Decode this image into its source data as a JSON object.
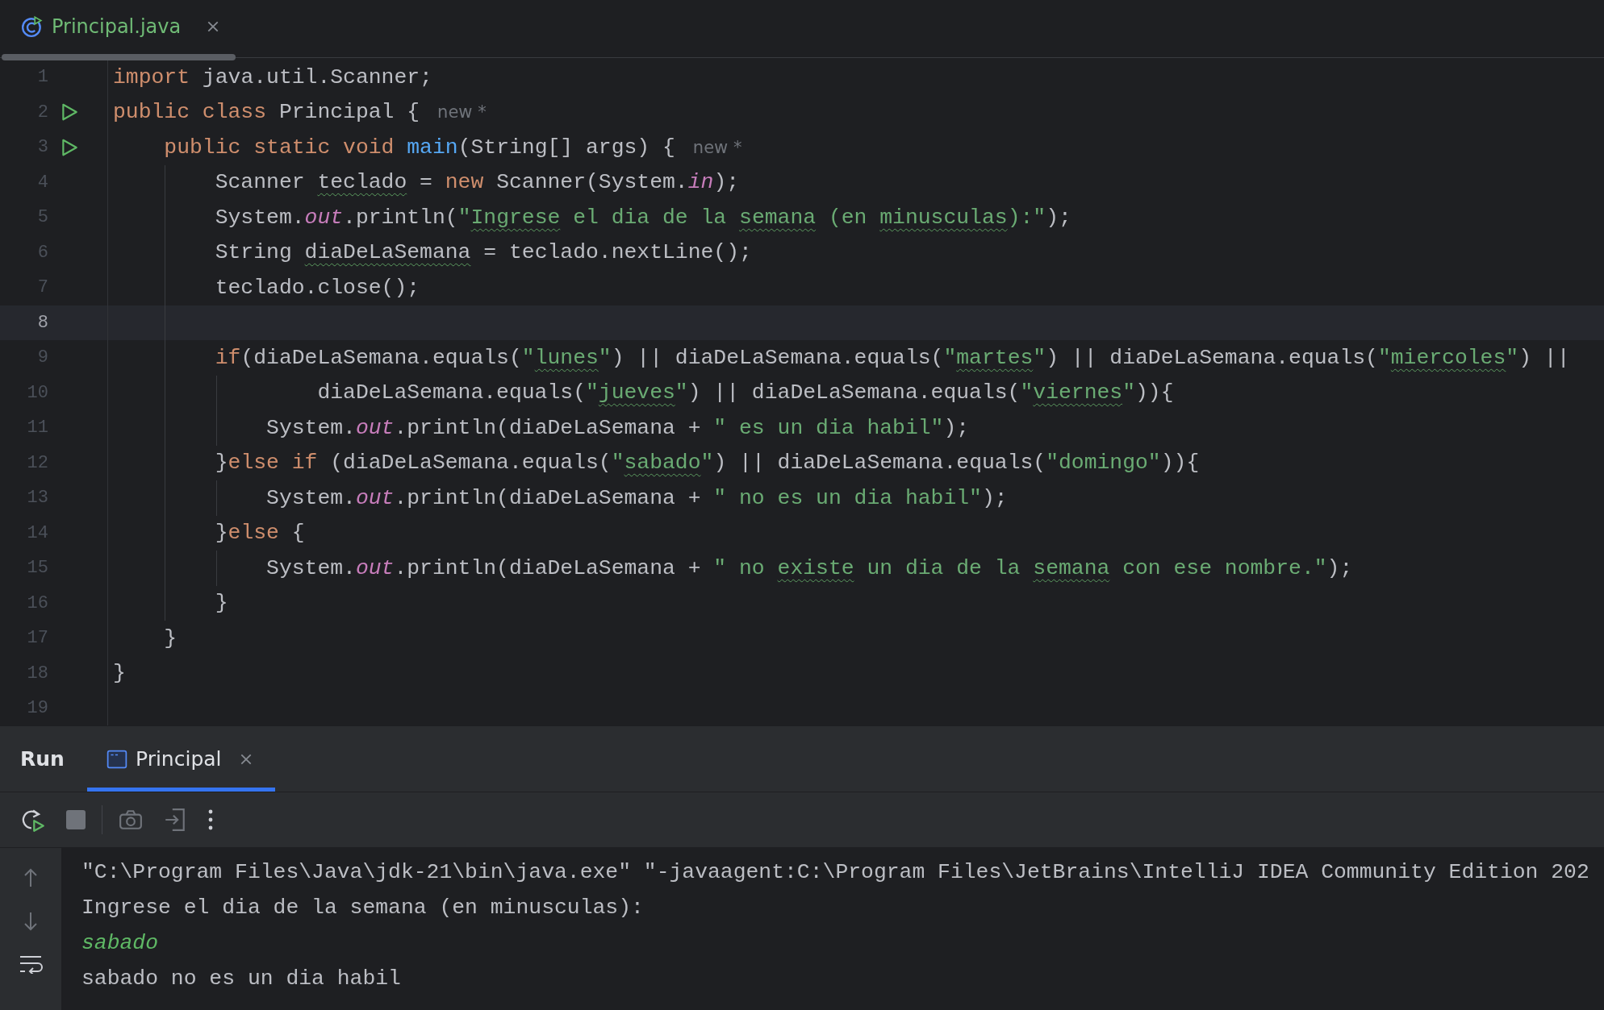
{
  "editor_tabs": [
    {
      "label": "Principal.java"
    }
  ],
  "code_lines": [
    {
      "no": "1",
      "run": false,
      "current": false,
      "tokens": [
        {
          "kind": "keyword",
          "text": "import"
        },
        {
          "kind": "plain",
          "text": " java.util.Scanner;"
        }
      ]
    },
    {
      "no": "2",
      "run": true,
      "current": false,
      "tokens": [
        {
          "kind": "keyword",
          "text": "public class"
        },
        {
          "kind": "plain",
          "text": " Principal {"
        }
      ],
      "hint": "new *"
    },
    {
      "no": "3",
      "run": true,
      "current": false,
      "tokens": [
        {
          "kind": "keyword",
          "text": "    public static void "
        },
        {
          "kind": "method",
          "text": "main"
        },
        {
          "kind": "plain",
          "text": "(String[] args) {"
        }
      ],
      "hint": "new *"
    },
    {
      "no": "4",
      "run": false,
      "current": false,
      "tokens": [
        {
          "kind": "plain",
          "text": "        Scanner "
        },
        {
          "kind": "misspelt",
          "text": "teclado"
        },
        {
          "kind": "plain",
          "text": " = "
        },
        {
          "kind": "keyword",
          "text": "new"
        },
        {
          "kind": "plain",
          "text": " Scanner(System."
        },
        {
          "kind": "field",
          "text": "in"
        },
        {
          "kind": "plain",
          "text": ");"
        }
      ]
    },
    {
      "no": "5",
      "run": false,
      "current": false,
      "tokens": [
        {
          "kind": "plain",
          "text": "        System."
        },
        {
          "kind": "field",
          "text": "out"
        },
        {
          "kind": "plain",
          "text": ".println("
        },
        {
          "kind": "string",
          "text": "\""
        },
        {
          "kind": "misspelt-string",
          "text": "Ingrese"
        },
        {
          "kind": "string",
          "text": " el dia de la "
        },
        {
          "kind": "misspelt-string",
          "text": "semana"
        },
        {
          "kind": "string",
          "text": " (en "
        },
        {
          "kind": "misspelt-string",
          "text": "minusculas"
        },
        {
          "kind": "string",
          "text": "):\""
        },
        {
          "kind": "plain",
          "text": ");"
        }
      ]
    },
    {
      "no": "6",
      "run": false,
      "current": false,
      "tokens": [
        {
          "kind": "plain",
          "text": "        String "
        },
        {
          "kind": "misspelt",
          "text": "diaDeLaSemana"
        },
        {
          "kind": "plain",
          "text": " = teclado.nextLine();"
        }
      ]
    },
    {
      "no": "7",
      "run": false,
      "current": false,
      "tokens": [
        {
          "kind": "plain",
          "text": "        teclado.close();"
        }
      ]
    },
    {
      "no": "8",
      "run": false,
      "current": true
    },
    {
      "no": "9",
      "run": false,
      "current": false,
      "tokens": [
        {
          "kind": "keyword",
          "text": "        if"
        },
        {
          "kind": "plain",
          "text": "(diaDeLaSemana.equals("
        },
        {
          "kind": "string",
          "text": "\""
        },
        {
          "kind": "misspelt-string",
          "text": "lunes"
        },
        {
          "kind": "string",
          "text": "\""
        },
        {
          "kind": "plain",
          "text": ") || diaDeLaSemana.equals("
        },
        {
          "kind": "string",
          "text": "\""
        },
        {
          "kind": "misspelt-string",
          "text": "martes"
        },
        {
          "kind": "string",
          "text": "\""
        },
        {
          "kind": "plain",
          "text": ") || diaDeLaSemana.equals("
        },
        {
          "kind": "string",
          "text": "\""
        },
        {
          "kind": "misspelt-string",
          "text": "miercoles"
        },
        {
          "kind": "string",
          "text": "\""
        },
        {
          "kind": "plain",
          "text": ") ||"
        }
      ]
    },
    {
      "no": "10",
      "run": false,
      "current": false,
      "tokens": [
        {
          "kind": "plain",
          "text": "                diaDeLaSemana.equals("
        },
        {
          "kind": "string",
          "text": "\""
        },
        {
          "kind": "misspelt-string",
          "text": "jueves"
        },
        {
          "kind": "string",
          "text": "\""
        },
        {
          "kind": "plain",
          "text": ") || diaDeLaSemana.equals("
        },
        {
          "kind": "string",
          "text": "\""
        },
        {
          "kind": "misspelt-string",
          "text": "viernes"
        },
        {
          "kind": "string",
          "text": "\""
        },
        {
          "kind": "plain",
          "text": ")){"
        }
      ]
    },
    {
      "no": "11",
      "run": false,
      "current": false,
      "tokens": [
        {
          "kind": "plain",
          "text": "            System."
        },
        {
          "kind": "field",
          "text": "out"
        },
        {
          "kind": "plain",
          "text": ".println(diaDeLaSemana + "
        },
        {
          "kind": "string",
          "text": "\" es un dia habil\""
        },
        {
          "kind": "plain",
          "text": ");"
        }
      ]
    },
    {
      "no": "12",
      "run": false,
      "current": false,
      "tokens": [
        {
          "kind": "plain",
          "text": "        }"
        },
        {
          "kind": "keyword",
          "text": "else if"
        },
        {
          "kind": "plain",
          "text": " (diaDeLaSemana.equals("
        },
        {
          "kind": "string",
          "text": "\""
        },
        {
          "kind": "misspelt-string",
          "text": "sabado"
        },
        {
          "kind": "string",
          "text": "\""
        },
        {
          "kind": "plain",
          "text": ") || diaDeLaSemana.equals("
        },
        {
          "kind": "string",
          "text": "\"domingo\""
        },
        {
          "kind": "plain",
          "text": ")){"
        }
      ]
    },
    {
      "no": "13",
      "run": false,
      "current": false,
      "tokens": [
        {
          "kind": "plain",
          "text": "            System."
        },
        {
          "kind": "field",
          "text": "out"
        },
        {
          "kind": "plain",
          "text": ".println(diaDeLaSemana + "
        },
        {
          "kind": "string",
          "text": "\" no es un dia habil\""
        },
        {
          "kind": "plain",
          "text": ");"
        }
      ]
    },
    {
      "no": "14",
      "run": false,
      "current": false,
      "tokens": [
        {
          "kind": "plain",
          "text": "        }"
        },
        {
          "kind": "keyword",
          "text": "else"
        },
        {
          "kind": "plain",
          "text": " {"
        }
      ]
    },
    {
      "no": "15",
      "run": false,
      "current": false,
      "tokens": [
        {
          "kind": "plain",
          "text": "            System."
        },
        {
          "kind": "field",
          "text": "out"
        },
        {
          "kind": "plain",
          "text": ".println(diaDeLaSemana + "
        },
        {
          "kind": "string",
          "text": "\" no "
        },
        {
          "kind": "misspelt-string",
          "text": "existe"
        },
        {
          "kind": "string",
          "text": " un dia de la "
        },
        {
          "kind": "misspelt-string",
          "text": "semana"
        },
        {
          "kind": "string",
          "text": " con ese nombre.\""
        },
        {
          "kind": "plain",
          "text": ");"
        }
      ]
    },
    {
      "no": "16",
      "run": false,
      "current": false,
      "tokens": [
        {
          "kind": "plain",
          "text": "        }"
        }
      ]
    },
    {
      "no": "17",
      "run": false,
      "current": false,
      "tokens": [
        {
          "kind": "plain",
          "text": "    }"
        }
      ]
    },
    {
      "no": "18",
      "run": false,
      "current": false,
      "tokens": [
        {
          "kind": "plain",
          "text": "}"
        }
      ]
    },
    {
      "no": "19",
      "run": false,
      "current": false
    }
  ],
  "run_panel": {
    "title": "Run",
    "tabs": [
      {
        "label": "Principal",
        "selected": true
      }
    ],
    "console_lines": [
      {
        "kind": "output",
        "text": "\"C:\\Program Files\\Java\\jdk-21\\bin\\java.exe\" \"-javaagent:C:\\Program Files\\JetBrains\\IntelliJ IDEA Community Edition 202"
      },
      {
        "kind": "output",
        "text": "Ingrese el dia de la semana (en minusculas):"
      },
      {
        "kind": "input",
        "text": "sabado"
      },
      {
        "kind": "output",
        "text": "sabado no es un dia habil"
      }
    ]
  }
}
